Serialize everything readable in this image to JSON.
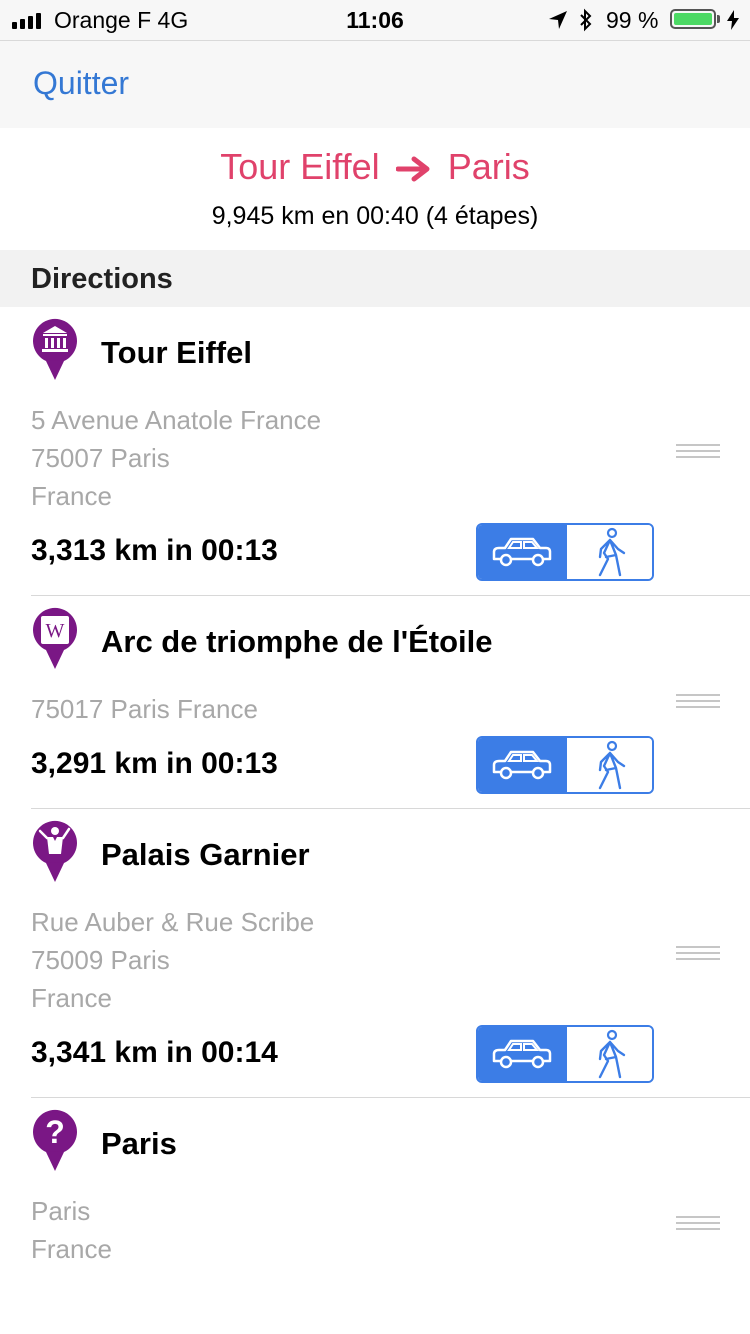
{
  "status": {
    "carrier": "Orange F   4G",
    "time": "11:06",
    "battery": "99 %",
    "battery_level": 0.99
  },
  "nav": {
    "quit": "Quitter"
  },
  "route": {
    "from": "Tour Eiffel",
    "to": "Paris",
    "summary": "9,945 km en 00:40 (4 étapes)"
  },
  "section": {
    "title": "Directions"
  },
  "steps": [
    {
      "name": "Tour Eiffel",
      "icon": "museum-icon",
      "address": [
        "5 Avenue Anatole France",
        "75007 Paris",
        "France"
      ],
      "distance": "3,313 km in 00:13",
      "mode": "car"
    },
    {
      "name": "Arc de triomphe de l'Étoile",
      "icon": "wikipedia-icon",
      "address": [
        "75017 Paris France"
      ],
      "distance": "3,291 km in 00:13",
      "mode": "car"
    },
    {
      "name": "Palais Garnier",
      "icon": "conductor-icon",
      "address": [
        "Rue Auber & Rue Scribe",
        "75009 Paris",
        "France"
      ],
      "distance": "3,341 km in 00:14",
      "mode": "car"
    },
    {
      "name": "Paris",
      "icon": "question-icon",
      "address": [
        "Paris",
        "France"
      ]
    }
  ],
  "colors": {
    "accent": "#3478d4",
    "route_title": "#e0426b",
    "pin": "#7a1785",
    "segment": "#3c7de6"
  }
}
